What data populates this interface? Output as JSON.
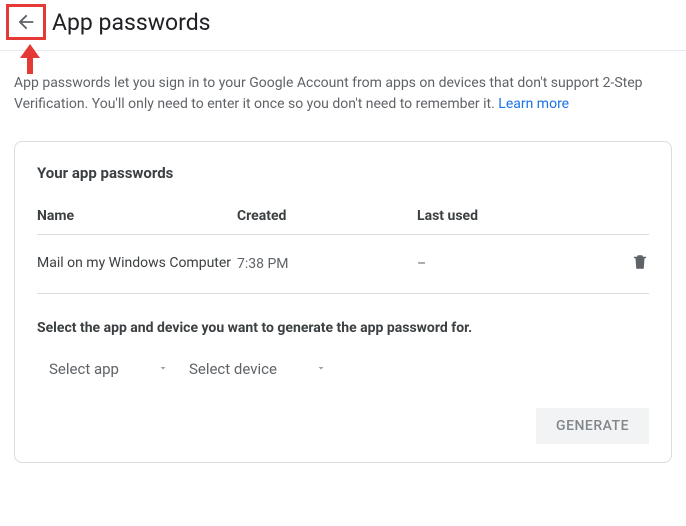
{
  "header": {
    "title": "App passwords"
  },
  "description": {
    "text": "App passwords let you sign in to your Google Account from apps on devices that don't support 2-Step Verification. You'll only need to enter it once so you don't need to remember it. ",
    "learn_more": "Learn more"
  },
  "card": {
    "title": "Your app passwords",
    "columns": {
      "name": "Name",
      "created": "Created",
      "last_used": "Last used"
    },
    "rows": [
      {
        "name": "Mail on my Windows Computer",
        "created": "7:38 PM",
        "last_used": "–"
      }
    ],
    "select_label": "Select the app and device you want to generate the app password for.",
    "select_app": "Select app",
    "select_device": "Select device",
    "generate": "GENERATE"
  }
}
